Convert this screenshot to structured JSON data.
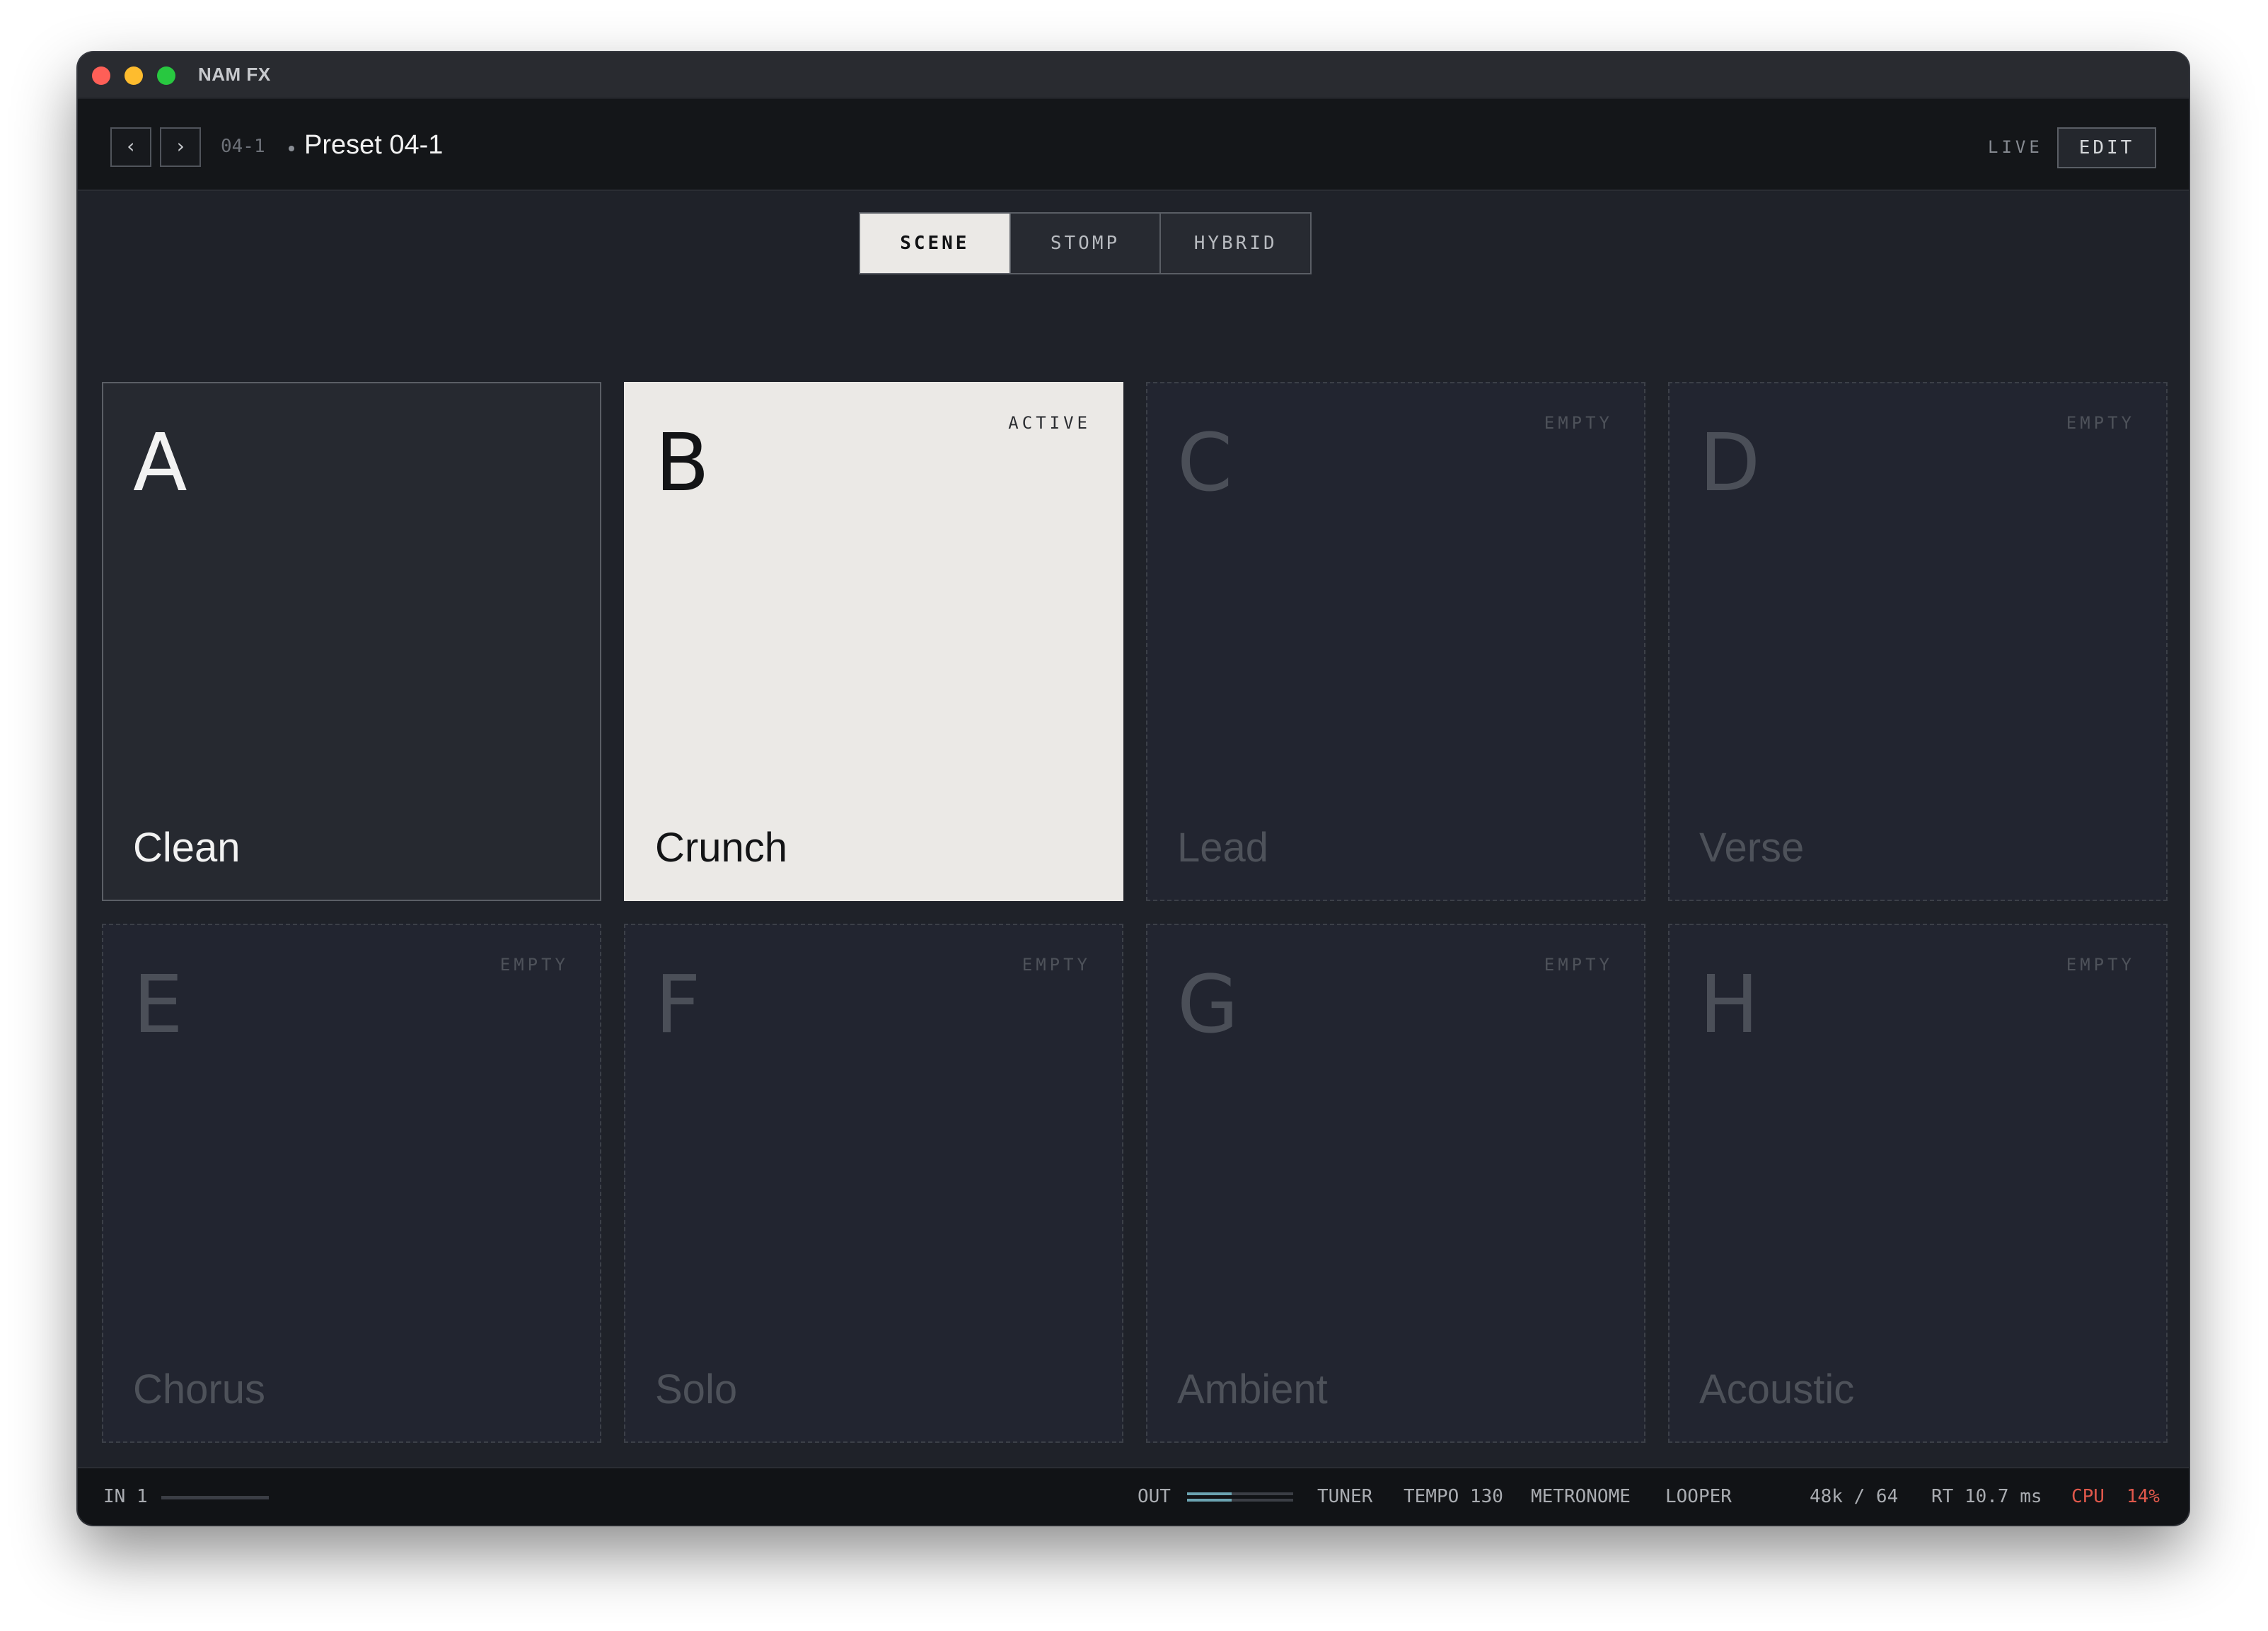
{
  "window": {
    "title": "NAM FX"
  },
  "header": {
    "prev_label": "‹",
    "next_label": "›",
    "preset_number": "04-1",
    "preset_name": "Preset 04-1",
    "live_label": "LIVE",
    "edit_label": "EDIT"
  },
  "modes": [
    {
      "label": "SCENE",
      "active": true
    },
    {
      "label": "STOMP",
      "active": false
    },
    {
      "label": "HYBRID",
      "active": false
    }
  ],
  "scenes": [
    {
      "letter": "A",
      "name": "Clean",
      "status": "",
      "state": "filled"
    },
    {
      "letter": "B",
      "name": "Crunch",
      "status": "ACTIVE",
      "state": "active"
    },
    {
      "letter": "C",
      "name": "Lead",
      "status": "EMPTY",
      "state": "empty"
    },
    {
      "letter": "D",
      "name": "Verse",
      "status": "EMPTY",
      "state": "empty"
    },
    {
      "letter": "E",
      "name": "Chorus",
      "status": "EMPTY",
      "state": "empty"
    },
    {
      "letter": "F",
      "name": "Solo",
      "status": "EMPTY",
      "state": "empty"
    },
    {
      "letter": "G",
      "name": "Ambient",
      "status": "EMPTY",
      "state": "empty"
    },
    {
      "letter": "H",
      "name": "Acoustic",
      "status": "EMPTY",
      "state": "empty"
    }
  ],
  "footer": {
    "input_label": "IN 1",
    "input_level": 0,
    "output_label": "OUT",
    "output_levels": [
      0.42,
      0.42
    ],
    "tuner_label": "TUNER",
    "tempo_label": "TEMPO 130",
    "metronome_label": "METRONOME",
    "looper_label": "LOOPER",
    "sample_rate": "48k / 64",
    "latency": "RT 10.7 ms",
    "cpu_label": "CPU",
    "cpu_value": "14%"
  },
  "colors": {
    "background": "#1f2229",
    "active_scene": "#ebe9e6",
    "cpu_warning": "#e0584b",
    "output_meter": "#6ba4b2"
  }
}
